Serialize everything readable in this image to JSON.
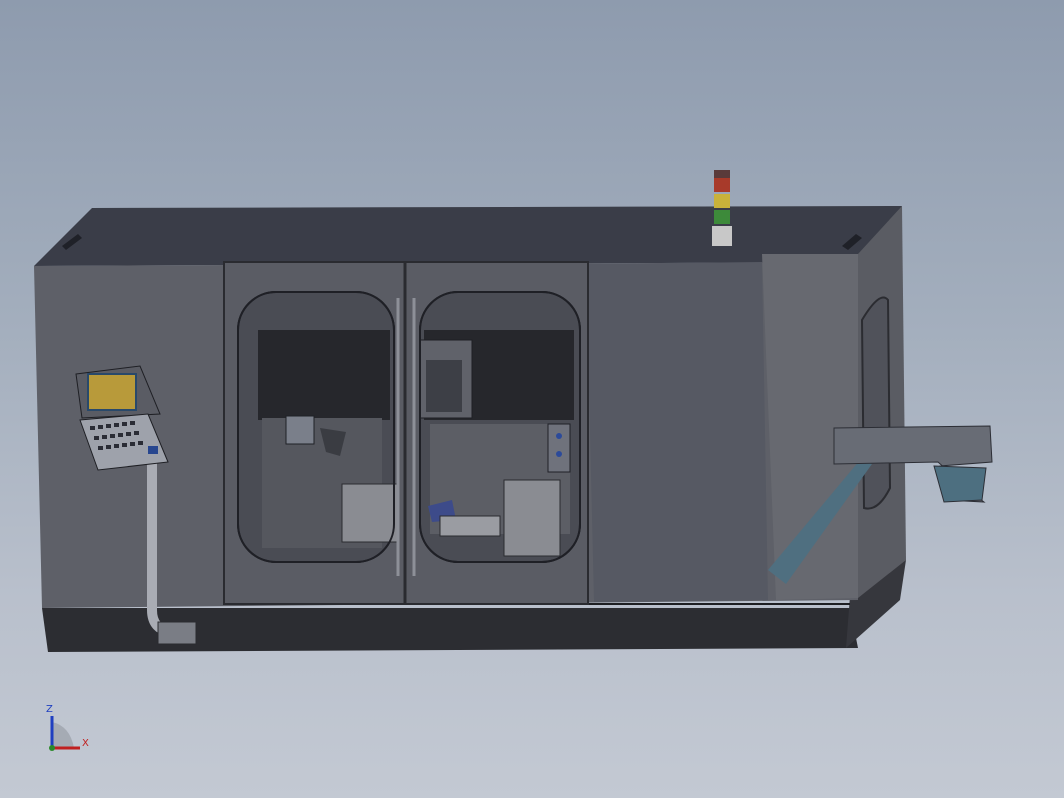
{
  "view": {
    "type": "cad-3d-viewport",
    "background_top": "#8e9bae",
    "background_bottom": "#c3c9d3"
  },
  "model": {
    "name": "",
    "body_color": "#5e6068",
    "top_color": "#3a3d48",
    "base_color": "#2c2d32",
    "accent_color": "#4f6f80"
  },
  "signal_tower": {
    "lights": [
      "red",
      "yellow",
      "green"
    ],
    "colors": [
      "#a83a2a",
      "#c9b23a",
      "#3d8a3a"
    ]
  },
  "control_panel": {
    "screen_color": "#b89a3a",
    "icon": "cnc-control-panel-icon"
  },
  "triad": {
    "z_label": "Z",
    "x_label": "X",
    "z_color": "#1f3fc0",
    "x_color": "#c02020",
    "y_color": "#2a8a2a"
  }
}
